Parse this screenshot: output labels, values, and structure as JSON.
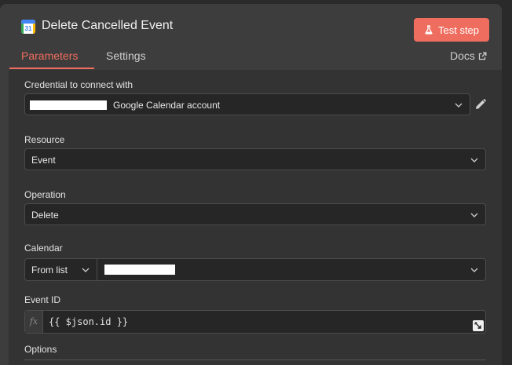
{
  "header": {
    "title": "Delete Cancelled Event",
    "app_icon_label": "31",
    "test_button_label": "Test step",
    "app_icon": "google-calendar-icon",
    "test_icon": "flask-icon"
  },
  "tabs": [
    {
      "label": "Parameters",
      "active": true
    },
    {
      "label": "Settings",
      "active": false
    }
  ],
  "docs_label": "Docs",
  "fields": {
    "credential": {
      "label": "Credential to connect with",
      "value_suffix": "Google Calendar account",
      "value_redacted": true
    },
    "resource": {
      "label": "Resource",
      "value": "Event"
    },
    "operation": {
      "label": "Operation",
      "value": "Delete"
    },
    "calendar": {
      "label": "Calendar",
      "mode": "From list",
      "value_redacted": true
    },
    "event_id": {
      "label": "Event ID",
      "expression": "{{ $json.id }}",
      "fx_label": "fx"
    },
    "options": {
      "label": "Options"
    }
  },
  "colors": {
    "accent": "#ef6d5e",
    "panel_bg": "#3d3d3d",
    "content_bg": "#333333",
    "field_bg": "#262626"
  }
}
